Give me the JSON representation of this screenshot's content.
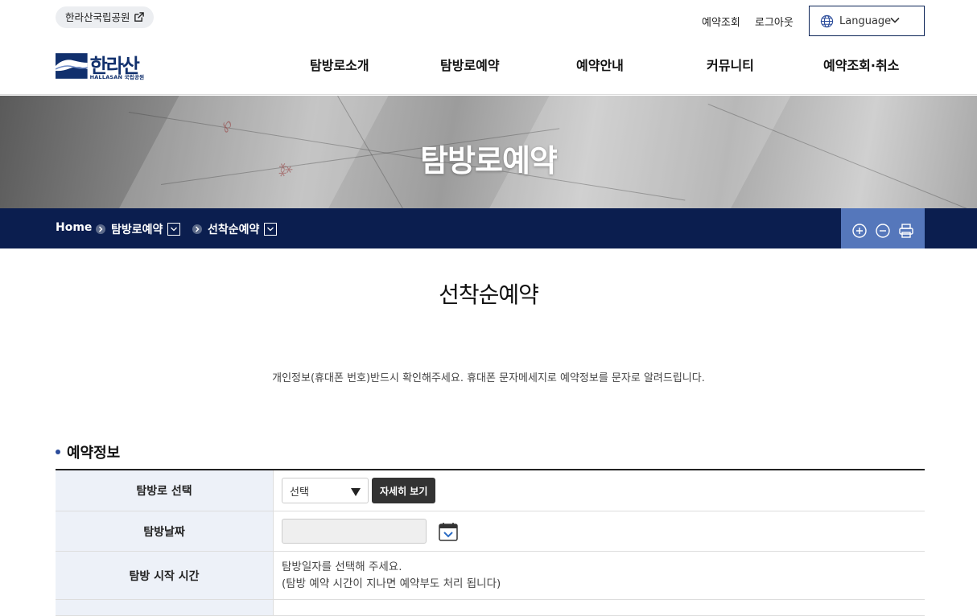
{
  "header": {
    "park_link": "한라산국립공원",
    "util_reserve": "예약조회",
    "util_logout": "로그아웃",
    "language": "Language",
    "logo_ko": "한라산",
    "logo_en": "HALLASAN 국립공원",
    "gnb": [
      "탐방로소개",
      "탐방로예약",
      "예약안내",
      "커뮤니티",
      "예약조회·취소"
    ]
  },
  "visual": {
    "title": "탐방로예약"
  },
  "breadcrumb": {
    "home": "Home",
    "level1": "탐방로예약",
    "level2": "선착순예약"
  },
  "page": {
    "title": "선착순예약",
    "notice": "개인정보(휴대폰 번호)반드시 확인해주세요. 휴대폰 문자메세지로 예약정보를 문자로 알려드립니다."
  },
  "section": {
    "title": "예약정보"
  },
  "form": {
    "trail_label": "탐방로 선택",
    "trail_select": "선택",
    "detail_button": "자세히 보기",
    "date_label": "탐방날짜",
    "time_label": "탐방 시작 시간",
    "time_info_1": "탐방일자를 선택해 주세요.",
    "time_info_2": "(탐방 예약 시간이 지나면 예약부도 처리 됩니다)"
  },
  "colors": {
    "navy": "#0b1e4f",
    "tool_blue": "#5577bb",
    "th_bg": "#edf1f8"
  }
}
